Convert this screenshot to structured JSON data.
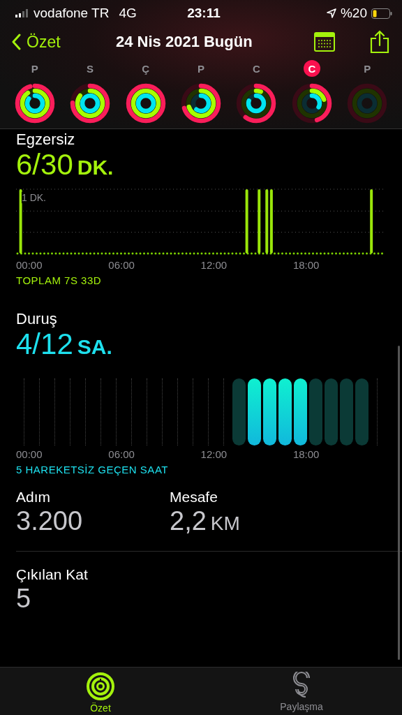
{
  "status_bar": {
    "carrier": "vodafone TR",
    "network": "4G",
    "time": "23:11",
    "battery": "%20"
  },
  "nav": {
    "back": "Özet",
    "title": "24 Nis 2021 Bugün"
  },
  "week": [
    {
      "day": "P",
      "selected": false
    },
    {
      "day": "S",
      "selected": false
    },
    {
      "day": "Ç",
      "selected": false
    },
    {
      "day": "P",
      "selected": false
    },
    {
      "day": "C",
      "selected": false
    },
    {
      "day": "C",
      "selected": true
    },
    {
      "day": "P",
      "selected": false
    }
  ],
  "exercise": {
    "title": "Egzersiz",
    "value": "6/30",
    "unit": "DK.",
    "scale_label": "1 DK.",
    "ticks": [
      "00:00",
      "06:00",
      "12:00",
      "18:00"
    ],
    "footer": "TOPLAM 7S 33D"
  },
  "stand": {
    "title": "Duruş",
    "value": "4/12",
    "unit": "SA.",
    "hours": [
      {
        "kind": "empty"
      },
      {
        "kind": "empty"
      },
      {
        "kind": "empty"
      },
      {
        "kind": "empty"
      },
      {
        "kind": "empty"
      },
      {
        "kind": "empty"
      },
      {
        "kind": "empty"
      },
      {
        "kind": "empty"
      },
      {
        "kind": "empty"
      },
      {
        "kind": "empty"
      },
      {
        "kind": "empty"
      },
      {
        "kind": "empty"
      },
      {
        "kind": "empty"
      },
      {
        "kind": "empty"
      },
      {
        "kind": "missed"
      },
      {
        "kind": "stood"
      },
      {
        "kind": "stood"
      },
      {
        "kind": "stood"
      },
      {
        "kind": "stood"
      },
      {
        "kind": "missed"
      },
      {
        "kind": "missed"
      },
      {
        "kind": "missed"
      },
      {
        "kind": "missed"
      },
      {
        "kind": "empty"
      }
    ],
    "ticks": [
      "00:00",
      "06:00",
      "12:00",
      "18:00"
    ],
    "footer": "5 HAREKETSİZ GEÇEN SAAT"
  },
  "stats": [
    {
      "label": "Adım",
      "value": "3.200"
    },
    {
      "label": "Mesafe",
      "value": "2,2",
      "unit": "KM"
    }
  ],
  "floors": {
    "label": "Çıkılan Kat",
    "value": "5"
  },
  "tabs": [
    {
      "label": "Özet",
      "selected": true,
      "kind": "rings"
    },
    {
      "label": "Paylaşma",
      "selected": false,
      "kind": "sharing"
    }
  ]
}
